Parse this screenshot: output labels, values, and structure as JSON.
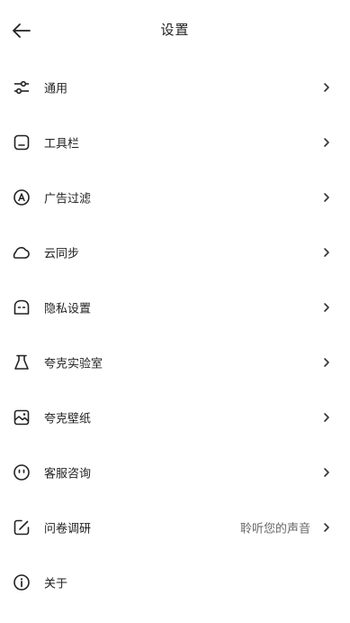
{
  "header": {
    "title": "设置",
    "back_icon": "arrow-left-icon"
  },
  "settings": [
    {
      "label": "通用",
      "icon": "sliders-icon",
      "value": "",
      "has_chevron": true
    },
    {
      "label": "工具栏",
      "icon": "toolbar-icon",
      "value": "",
      "has_chevron": true
    },
    {
      "label": "广告过滤",
      "icon": "ad-block-icon",
      "value": "",
      "has_chevron": true
    },
    {
      "label": "云同步",
      "icon": "cloud-icon",
      "value": "",
      "has_chevron": true
    },
    {
      "label": "隐私设置",
      "icon": "privacy-icon",
      "value": "",
      "has_chevron": true
    },
    {
      "label": "夸克实验室",
      "icon": "flask-icon",
      "value": "",
      "has_chevron": true
    },
    {
      "label": "夸克壁纸",
      "icon": "wallpaper-icon",
      "value": "",
      "has_chevron": true
    },
    {
      "label": "客服咨询",
      "icon": "support-icon",
      "value": "",
      "has_chevron": true
    },
    {
      "label": "问卷调研",
      "icon": "survey-icon",
      "value": "聆听您的声音",
      "has_chevron": true
    },
    {
      "label": "关于",
      "icon": "info-icon",
      "value": "",
      "has_chevron": false
    }
  ],
  "colors": {
    "text": "#222222",
    "secondary_text": "#666666",
    "background": "#ffffff"
  }
}
